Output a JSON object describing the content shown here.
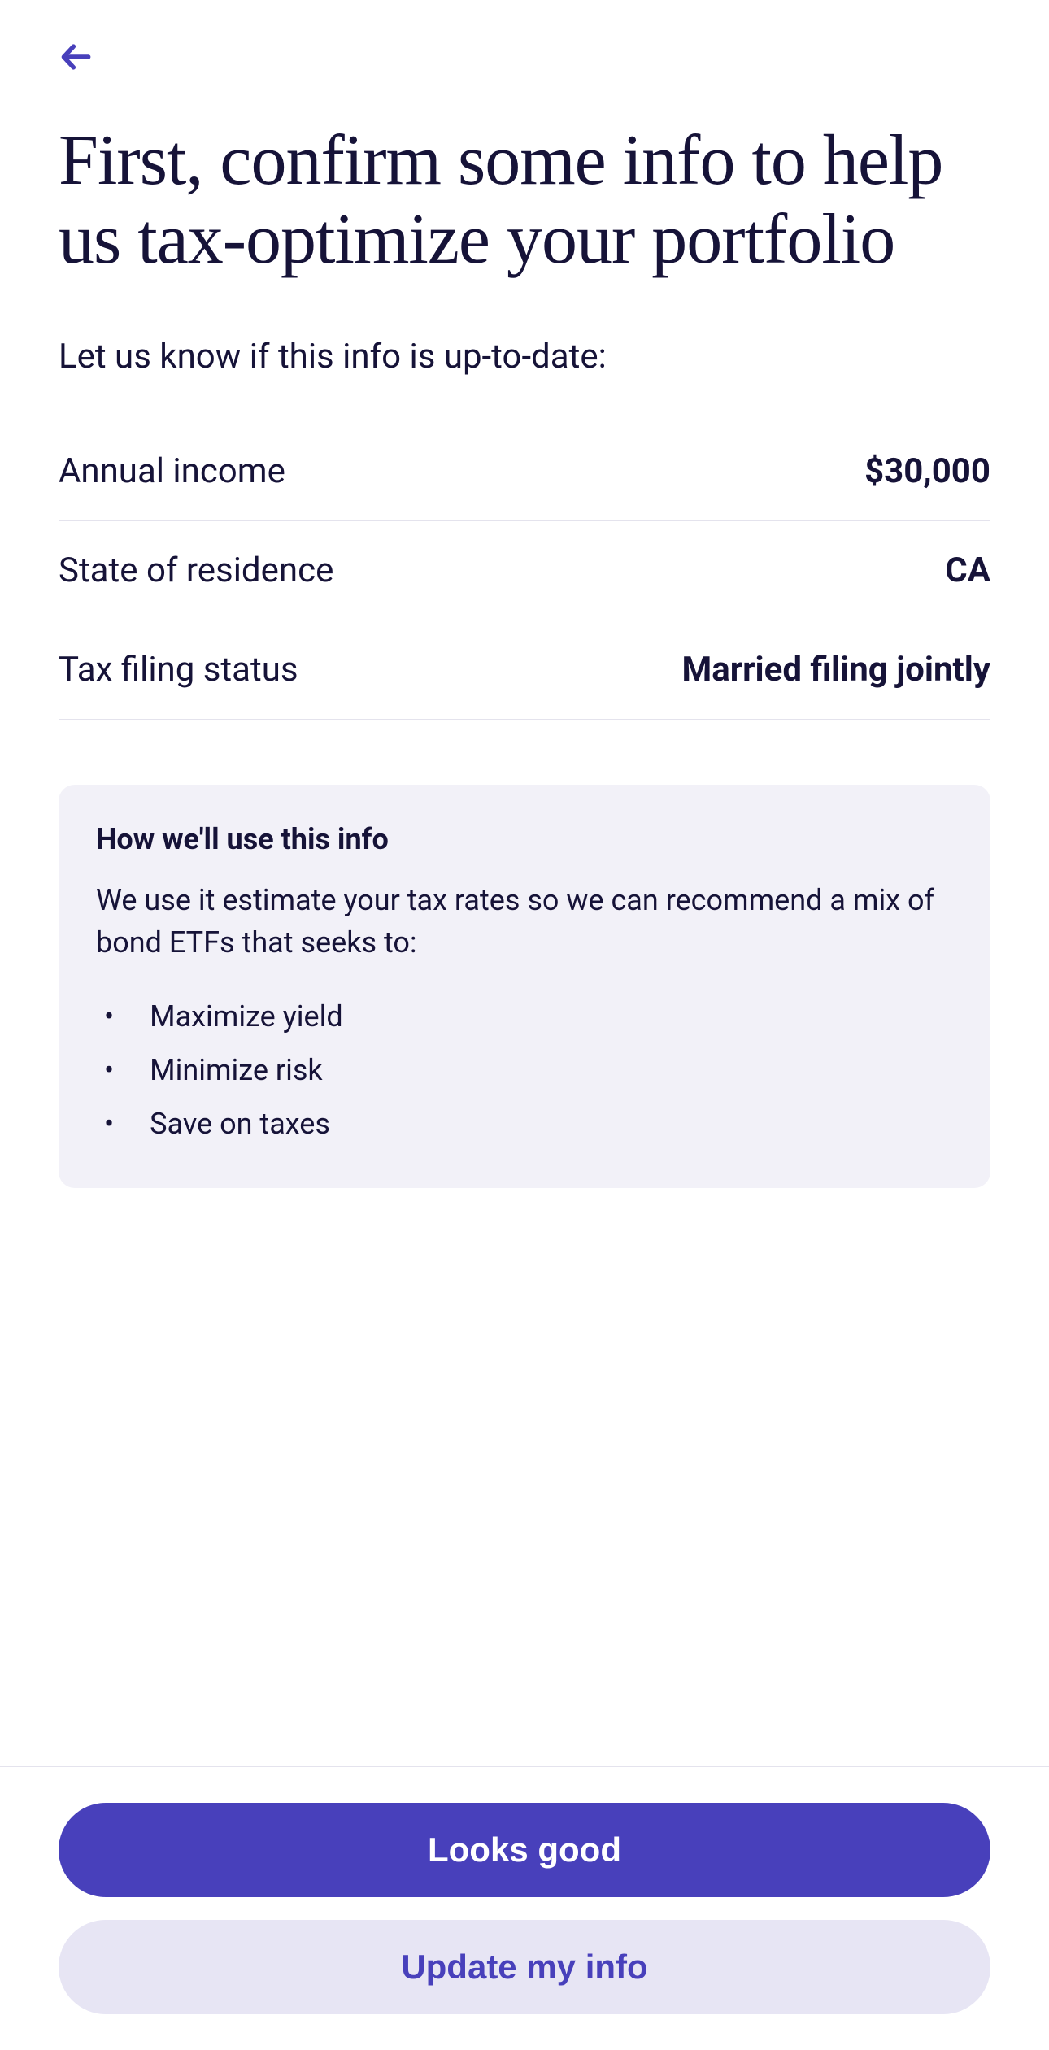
{
  "heading": "First, confirm some info to help us tax-optimize your portfolio",
  "subtext": "Let us know if this info is up-to-date:",
  "rows": {
    "income": {
      "label": "Annual income",
      "value": "$30,000"
    },
    "state": {
      "label": "State of residence",
      "value": "CA"
    },
    "filing": {
      "label": "Tax filing status",
      "value": "Married filing jointly"
    }
  },
  "card": {
    "title": "How we'll use this info",
    "body": "We use it estimate your tax rates so we can recommend a mix of bond ETFs that seeks to:",
    "items": {
      "0": "Maximize yield",
      "1": "Minimize risk",
      "2": "Save on taxes"
    }
  },
  "buttons": {
    "primary": "Looks good",
    "secondary": "Update my info"
  }
}
